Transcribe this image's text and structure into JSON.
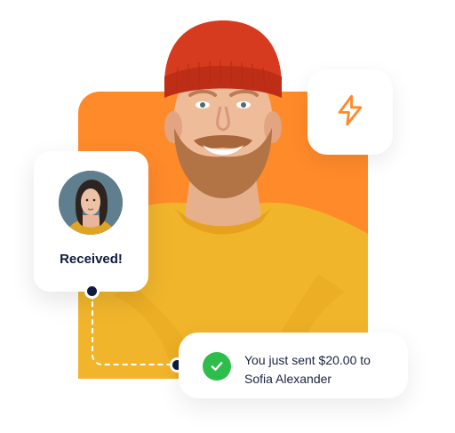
{
  "colors": {
    "accent_orange": "#ff8a2a",
    "navy": "#0f1a3d",
    "success_green": "#2ebd4a",
    "sweater_yellow": "#f1b52c",
    "beanie_red": "#d73b1f"
  },
  "icons": {
    "lightning": "lightning-icon",
    "check": "check-icon"
  },
  "received_card": {
    "label": "Received!"
  },
  "notification": {
    "line1": "You just sent $20.00 to",
    "line2": "Sofia Alexander"
  }
}
